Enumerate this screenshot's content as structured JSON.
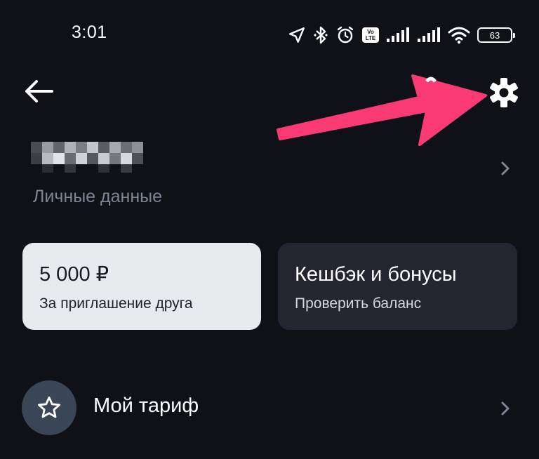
{
  "status_bar": {
    "time": "3:01",
    "battery_level": "63",
    "volte_label_top": "Vo",
    "volte_label_bottom": "LTE",
    "icons": [
      "location-arrow-icon",
      "bluetooth-icon",
      "alarm-icon",
      "volte-icon",
      "signal-icon",
      "signal-icon",
      "wifi-icon",
      "battery-icon"
    ]
  },
  "header": {
    "back_icon": "arrow-left-icon",
    "settings_icon": "gear-icon"
  },
  "profile": {
    "subtitle": "Личные данные",
    "name_redacted": true
  },
  "cards": [
    {
      "title": "5 000 ₽",
      "subtitle": "За приглашение друга"
    },
    {
      "title": "Кешбэк и бонусы",
      "subtitle": "Проверить баланс"
    }
  ],
  "menu": {
    "tariff": {
      "label": "Мой тариф",
      "icon": "star-icon"
    }
  },
  "colors": {
    "background": "#0f1117",
    "card_light": "#e9eaee",
    "card_dark": "#232631",
    "subtle_text": "#7f8595",
    "icon_circle": "#3a4556",
    "annotation_arrow": "#f93a75"
  }
}
